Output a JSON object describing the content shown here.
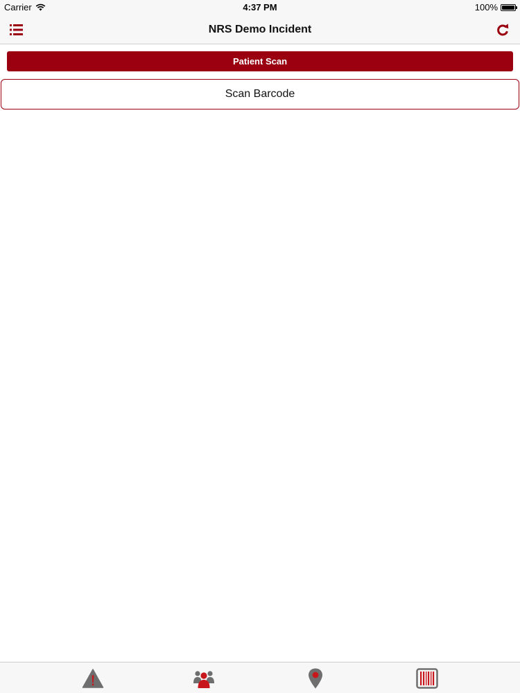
{
  "status_bar": {
    "carrier": "Carrier",
    "time": "4:37 PM",
    "battery_percent": "100%",
    "battery_level": 1.0,
    "wifi_icon": "wifi-icon"
  },
  "nav_bar": {
    "title": "NRS Demo Incident",
    "left_icon": "list-icon",
    "right_icon": "refresh-icon"
  },
  "section": {
    "header": "Patient Scan"
  },
  "scan": {
    "button_label": "Scan Barcode"
  },
  "tab_bar": {
    "tabs": [
      {
        "icon": "warning-icon",
        "selected": false
      },
      {
        "icon": "patients-icon",
        "selected": true
      },
      {
        "icon": "location-pin-icon",
        "selected": false
      },
      {
        "icon": "barcode-icon",
        "selected": false
      }
    ]
  },
  "colors": {
    "accent": "#9a0010",
    "inactive_icon": "#6e6e6e",
    "active_icon": "#c8161d",
    "bar_background": "#f7f7f7"
  }
}
